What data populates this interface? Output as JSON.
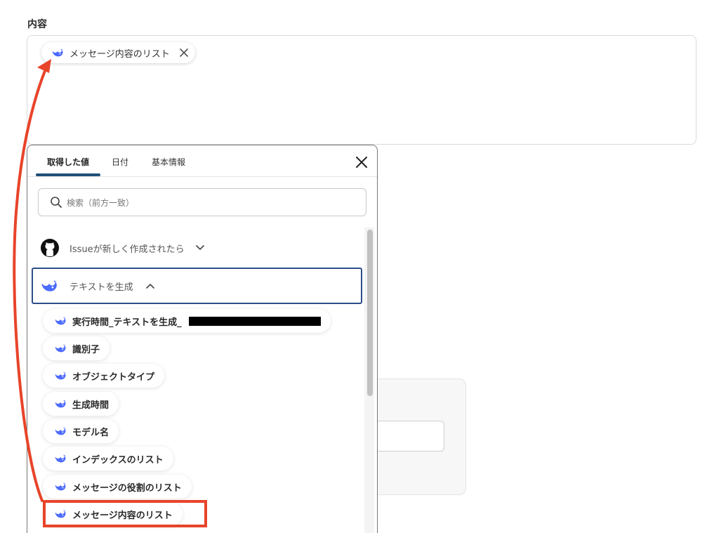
{
  "field": {
    "label": "内容",
    "token_label": "メッセージ内容のリスト"
  },
  "popover": {
    "tabs": [
      {
        "label": "取得した値",
        "active": true
      },
      {
        "label": "日付",
        "active": false
      },
      {
        "label": "基本情報",
        "active": false
      }
    ],
    "search_placeholder": "検索（前方一致）",
    "groups": {
      "github": {
        "label": "Issueが新しく作成されたら",
        "expanded": false
      },
      "ai": {
        "label": "テキストを生成",
        "expanded": true
      }
    },
    "items": [
      {
        "label": "実行時間_テキストを生成_",
        "redacted": true
      },
      {
        "label": "識別子"
      },
      {
        "label": "オブジェクトタイプ"
      },
      {
        "label": "生成時間"
      },
      {
        "label": "モデル名"
      },
      {
        "label": "インデックスのリスト"
      },
      {
        "label": "メッセージの役割のリスト"
      },
      {
        "label": "メッセージ内容のリスト",
        "highlighted": true
      }
    ]
  },
  "icons": {
    "ai_whale": "whale-icon",
    "github": "github-icon",
    "search": "search-icon",
    "close": "close-icon"
  },
  "colors": {
    "whale_blue": "#4d6bfe",
    "tab_underline": "#1f4f7a",
    "group_border": "#2d4d8a",
    "annotation_red": "#e8442a"
  }
}
